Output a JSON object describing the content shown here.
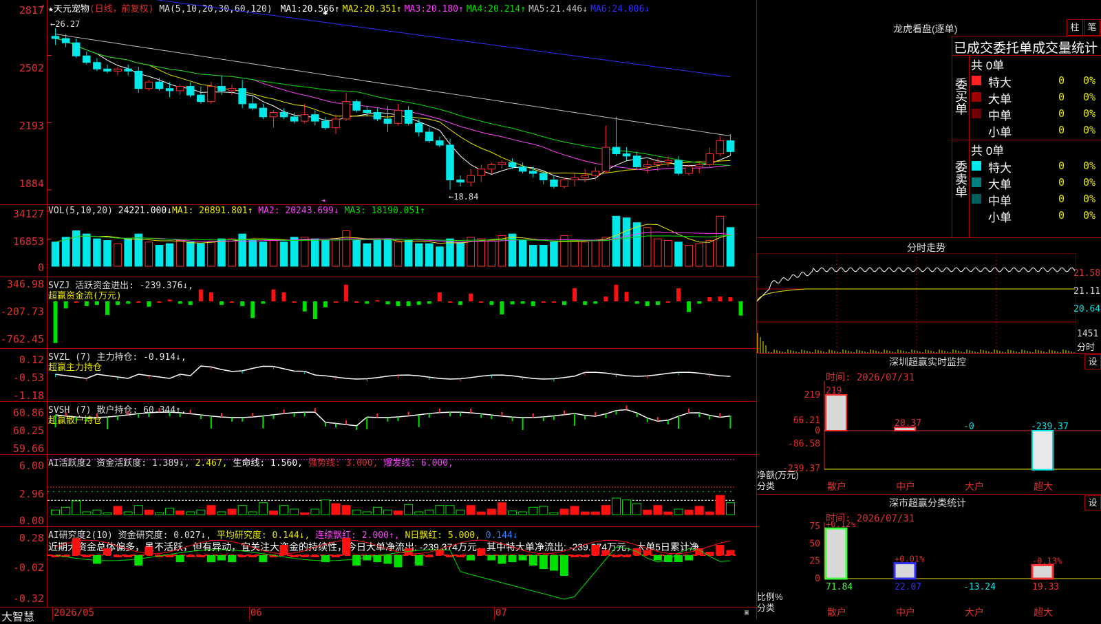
{
  "main": {
    "title": "★天元宠物",
    "subtitle": "(日线，前复权)",
    "ma_header": "MA(5,10,20,30,60,120)",
    "ma_values": [
      {
        "label": "MA1:",
        "value": "20.566↑",
        "color": "#ffffff"
      },
      {
        "label": "MA2:",
        "value": "20.351↑",
        "color": "#e8e800"
      },
      {
        "label": "MA3:",
        "value": "20.180↑",
        "color": "#ff40ff"
      },
      {
        "label": "MA4:",
        "value": "20.214↑",
        "color": "#00e000"
      },
      {
        "label": "MA5:",
        "value": "21.446↓",
        "color": "#c0c0c0"
      },
      {
        "label": "MA6:",
        "value": "24.006↓",
        "color": "#3030ff"
      }
    ],
    "y_labels": [
      "2817",
      "2502",
      "2193",
      "1884"
    ],
    "high_marker": "←26.27",
    "low_marker": "←18.84"
  },
  "vol": {
    "header": "VOL(5,10,20)",
    "value": "24221.000↓",
    "ma1": "MA1: 20891.801↑",
    "ma2": "MA2: 20243.699↓",
    "ma3": "MA3: 18190.051↑",
    "y_labels": [
      "34127",
      "16853",
      "0"
    ]
  },
  "svzj": {
    "header": "SVZJ  活跃资金进出: -239.376↓,",
    "sub": "超赢资金流(万元)",
    "y_labels": [
      "346.98",
      "-207.73",
      "-762.45"
    ]
  },
  "svzl": {
    "header": "SVZL (7) 主力持仓: -0.914↓,",
    "sub": "超赢主力持仓",
    "y_labels": [
      "0.12",
      "-0.53",
      "-1.18"
    ]
  },
  "svsh": {
    "header": "SVSH (7) 散户持仓: 60.344↑,",
    "sub": "超赢散户持仓",
    "y_labels": [
      "60.86",
      "60.25",
      "59.66"
    ]
  },
  "ai1": {
    "header": "AI活跃度2 资金活跃度: 1.389↓,",
    "v2": "2.467,",
    "v3": "生命线: 1.560,",
    "v4": "强势线: 3.000,",
    "v5": "爆发线: 6.000,",
    "y_labels": [
      "6.00",
      "2.96",
      "0.00"
    ]
  },
  "ai2": {
    "header": "AI研究度2(10) 资金研究度: 0.027↓,",
    "v2": "平均研究度: 0.144↓,",
    "v3": "连续飘红: 2.000↑,",
    "v4": "N日飘红: 5.000,",
    "v5": "0.144↓",
    "comment": "近期大资金总体偏多，虽不活跃，但有异动，宜关注大资金的持续性，今日大单净流出: -239.374万元，其中特大单净流出: -239.374万元，大单5日累计净",
    "y_labels": [
      "0.28",
      "-0.02",
      "-0.32"
    ]
  },
  "bottom": {
    "brand": "大智慧",
    "dates": [
      "2026/05",
      "06",
      "07"
    ]
  },
  "right": {
    "longhu_title": "龙虎看盘(逐单)",
    "btn_bar": "柱",
    "btn_bi": "笔",
    "stats_title": "已成交委托单成交量统计",
    "buy_label": "委买单",
    "sell_label": "委卖单",
    "buy_total": "共 0单",
    "sell_total": "共 0单",
    "buy_rows": [
      {
        "name": "特大",
        "count": "0",
        "pct": "0%",
        "color": "#ff2020"
      },
      {
        "name": "大单",
        "count": "0",
        "pct": "0%",
        "color": "#a00000"
      },
      {
        "name": "中单",
        "count": "0",
        "pct": "0%",
        "color": "#700000"
      },
      {
        "name": "小单",
        "count": "0",
        "pct": "0%",
        "color": ""
      }
    ],
    "sell_rows": [
      {
        "name": "特大",
        "count": "0",
        "pct": "0%",
        "color": "#00e8e8"
      },
      {
        "name": "大单",
        "count": "0",
        "pct": "0%",
        "color": "#008080"
      },
      {
        "name": "中单",
        "count": "0",
        "pct": "0%",
        "color": "#006060"
      },
      {
        "name": "小单",
        "count": "0",
        "pct": "0%",
        "color": ""
      }
    ],
    "intraday_title": "分时走势",
    "intraday_y": [
      "21.58",
      "21.11",
      "20.64"
    ],
    "intraday_vol": "1451",
    "intraday_vol_lbl": "分时",
    "sz_title": "深圳超赢实时监控",
    "sz_btn": "设",
    "sz_time": "时间: 2026/07/31",
    "sz_y": [
      "219",
      "66.21",
      "0",
      "-86.58",
      "-239.37"
    ],
    "sz_axis_lbl1": "净额(万元)",
    "sz_axis_lbl2": "分类",
    "sz_bars": [
      {
        "cat": "散户",
        "value": 219,
        "label": "219"
      },
      {
        "cat": "中户",
        "value": 20.37,
        "label": "20.37"
      },
      {
        "cat": "大户",
        "value": 0,
        "label": "-0"
      },
      {
        "cat": "超大",
        "value": -239.37,
        "label": "-239.37"
      }
    ],
    "sm_title": "深市超赢分类统计",
    "sm_btn": "设",
    "sm_time": "时间: 2026/07/31",
    "sm_y": [
      "75",
      "50",
      "25",
      "0"
    ],
    "sm_axis_lbl1": "比例%",
    "sm_axis_lbl2": "分类",
    "sm_bars": [
      {
        "cat": "散户",
        "value": 71.84,
        "label": "71.84",
        "top": "+0.12%",
        "color": "#40ff40"
      },
      {
        "cat": "中户",
        "value": 22.07,
        "label": "22.07",
        "top": "+0.01%",
        "color": "#3030ff"
      },
      {
        "cat": "大户",
        "value": -13.24,
        "label": "-13.24",
        "top": "",
        "color": "#00e8e8"
      },
      {
        "cat": "超大",
        "value": 19.33,
        "label": "19.33",
        "top": "-0.13%",
        "color": "#ff3030"
      }
    ]
  },
  "chart_data": {
    "type": "candlestick",
    "x_axis_labels": [
      "2026/05",
      "06",
      "07"
    ],
    "candles": [
      [
        25.9,
        26.27,
        25.5,
        25.8
      ],
      [
        25.8,
        26.0,
        25.4,
        25.6
      ],
      [
        25.6,
        25.8,
        24.9,
        25.0
      ],
      [
        25.0,
        25.2,
        24.6,
        24.7
      ],
      [
        24.7,
        24.9,
        24.3,
        24.4
      ],
      [
        24.4,
        24.6,
        24.2,
        24.3
      ],
      [
        24.3,
        24.5,
        24.1,
        24.4
      ],
      [
        24.4,
        24.6,
        24.1,
        24.3
      ],
      [
        24.3,
        24.5,
        23.3,
        23.5
      ],
      [
        23.5,
        23.9,
        23.4,
        23.8
      ],
      [
        23.8,
        24.0,
        23.4,
        23.5
      ],
      [
        23.5,
        23.8,
        23.1,
        23.4
      ],
      [
        23.4,
        23.7,
        23.2,
        23.6
      ],
      [
        23.6,
        23.8,
        23.1,
        23.2
      ],
      [
        23.2,
        23.6,
        22.8,
        22.9
      ],
      [
        22.9,
        23.8,
        22.8,
        23.6
      ],
      [
        23.6,
        24.1,
        23.2,
        23.4
      ],
      [
        23.4,
        23.7,
        23.2,
        23.5
      ],
      [
        23.5,
        23.9,
        22.6,
        22.8
      ],
      [
        22.8,
        23.2,
        22.5,
        22.6
      ],
      [
        22.6,
        22.8,
        22.1,
        22.2
      ],
      [
        22.2,
        22.5,
        21.7,
        22.4
      ],
      [
        22.4,
        22.6,
        22.1,
        22.2
      ],
      [
        22.2,
        22.4,
        21.9,
        22.0
      ],
      [
        22.0,
        22.8,
        21.9,
        22.3
      ],
      [
        22.3,
        22.5,
        21.8,
        22.0
      ],
      [
        22.0,
        22.2,
        21.6,
        21.7
      ],
      [
        21.7,
        22.3,
        21.4,
        22.1
      ],
      [
        22.1,
        23.3,
        22.0,
        22.9
      ],
      [
        22.9,
        23.0,
        22.4,
        22.5
      ],
      [
        22.5,
        22.7,
        22.2,
        22.4
      ],
      [
        22.4,
        22.6,
        22.0,
        22.1
      ],
      [
        22.1,
        22.7,
        21.5,
        21.9
      ],
      [
        21.9,
        22.8,
        21.8,
        22.5
      ],
      [
        22.5,
        22.7,
        21.8,
        21.9
      ],
      [
        21.9,
        22.1,
        21.3,
        21.5
      ],
      [
        21.5,
        21.7,
        21.0,
        21.1
      ],
      [
        21.1,
        21.3,
        20.8,
        20.9
      ],
      [
        20.9,
        21.2,
        18.84,
        19.3
      ],
      [
        19.3,
        19.5,
        19.0,
        19.2
      ],
      [
        19.2,
        19.8,
        19.0,
        19.5
      ],
      [
        19.5,
        20.0,
        19.2,
        19.8
      ],
      [
        19.8,
        20.1,
        19.6,
        20.0
      ],
      [
        20.0,
        20.2,
        19.8,
        20.1
      ],
      [
        20.1,
        20.3,
        19.8,
        19.9
      ],
      [
        19.9,
        20.1,
        19.6,
        19.7
      ],
      [
        19.7,
        19.9,
        19.4,
        19.6
      ],
      [
        19.6,
        19.7,
        19.1,
        19.3
      ],
      [
        19.3,
        19.5,
        18.9,
        19.0
      ],
      [
        19.0,
        19.4,
        18.9,
        19.3
      ],
      [
        19.3,
        19.6,
        19.0,
        19.4
      ],
      [
        19.4,
        19.8,
        19.2,
        19.5
      ],
      [
        19.5,
        19.9,
        19.3,
        19.7
      ],
      [
        19.7,
        21.8,
        19.6,
        20.8
      ],
      [
        20.8,
        22.2,
        20.4,
        20.5
      ],
      [
        20.5,
        20.8,
        20.2,
        20.4
      ],
      [
        20.4,
        20.6,
        19.8,
        19.9
      ],
      [
        19.9,
        20.2,
        19.6,
        20.0
      ],
      [
        20.0,
        20.3,
        19.7,
        20.1
      ],
      [
        20.1,
        20.4,
        19.9,
        20.2
      ],
      [
        20.2,
        20.4,
        19.5,
        19.6
      ],
      [
        19.6,
        20.0,
        19.5,
        19.9
      ],
      [
        19.9,
        20.1,
        19.6,
        20.0
      ],
      [
        20.0,
        20.8,
        19.9,
        20.5
      ],
      [
        20.5,
        21.3,
        20.4,
        21.1
      ],
      [
        21.1,
        21.4,
        20.4,
        20.6
      ]
    ]
  }
}
